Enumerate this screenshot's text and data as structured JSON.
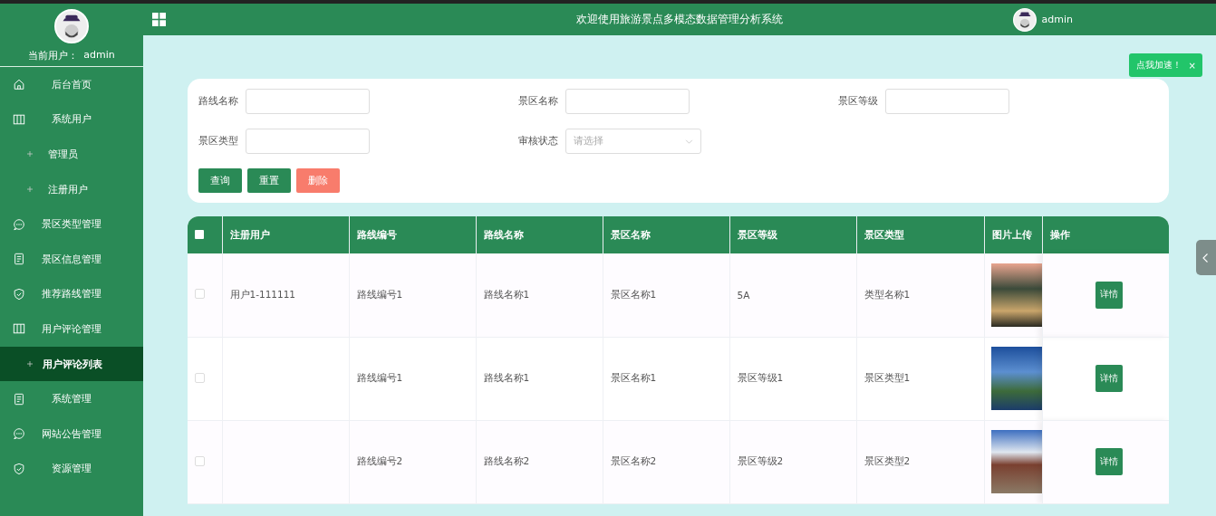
{
  "sidebar": {
    "current_user_label": "当前用户：",
    "current_user": "admin",
    "items": [
      {
        "label": "后台首页",
        "kind": "home",
        "selected": false
      },
      {
        "label": "系统用户",
        "kind": "columns",
        "selected": false
      },
      {
        "label": "管理员",
        "kind": "sub",
        "selected": false
      },
      {
        "label": "注册用户",
        "kind": "sub",
        "selected": false
      },
      {
        "label": "景区类型管理",
        "kind": "chat",
        "selected": false
      },
      {
        "label": "景区信息管理",
        "kind": "doc",
        "selected": false
      },
      {
        "label": "推荐路线管理",
        "kind": "shield",
        "selected": false
      },
      {
        "label": "用户评论管理",
        "kind": "columns",
        "selected": false
      },
      {
        "label": "用户评论列表",
        "kind": "sub",
        "selected": true
      },
      {
        "label": "系统管理",
        "kind": "doc",
        "selected": false
      },
      {
        "label": "网站公告管理",
        "kind": "chat",
        "selected": false
      },
      {
        "label": "资源管理",
        "kind": "shield",
        "selected": false
      }
    ]
  },
  "topbar": {
    "title": "欢迎使用旅游景点多模态数据管理分析系统",
    "user": "admin"
  },
  "filters": {
    "fields": [
      {
        "label": "路线名称",
        "kind": "input"
      },
      {
        "label": "景区名称",
        "kind": "input"
      },
      {
        "label": "景区等级",
        "kind": "input"
      },
      {
        "label": "景区类型",
        "kind": "input"
      },
      {
        "label": "审核状态",
        "kind": "select",
        "placeholder": "请选择"
      }
    ],
    "buttons": [
      {
        "label": "查询",
        "kind": "primary"
      },
      {
        "label": "重置",
        "kind": "primary"
      },
      {
        "label": "删除",
        "kind": "danger"
      }
    ]
  },
  "toast": {
    "text": "点我加速！",
    "close": "×"
  },
  "table": {
    "select_all_checked": false,
    "columns": [
      "注册用户",
      "路线编号",
      "路线名称",
      "景区名称",
      "景区等级",
      "景区类型",
      "图片上传",
      "操作"
    ],
    "rows": [
      {
        "checked": false,
        "cells": [
          "用户1-111111",
          "路线编号1",
          "路线名称1",
          "景区名称1",
          "5A",
          "类型名称1"
        ],
        "action": "详情"
      },
      {
        "checked": false,
        "cells": [
          "",
          "路线编号1",
          "路线名称1",
          "景区名称1",
          "景区等级1",
          "景区类型1"
        ],
        "action": "详情"
      },
      {
        "checked": false,
        "cells": [
          "",
          "路线编号2",
          "路线名称2",
          "景区名称2",
          "景区等级2",
          "景区类型2"
        ],
        "action": "详情"
      }
    ]
  }
}
